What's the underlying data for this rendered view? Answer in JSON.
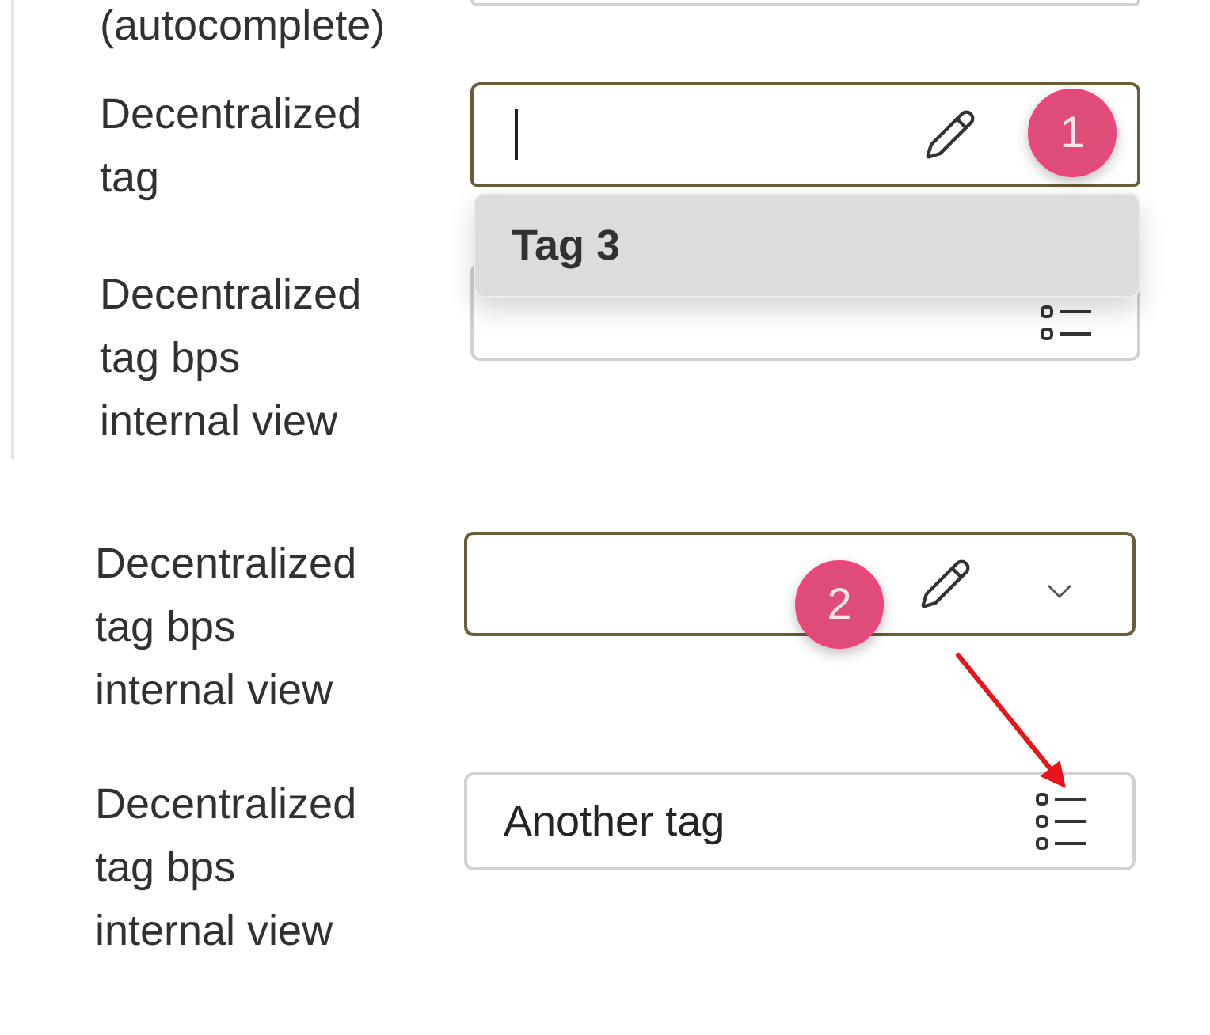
{
  "panels": [
    {
      "kind": "bordered",
      "rows": [
        {
          "label": "(autocomplete)",
          "field": {
            "kind": "clipped",
            "active": false
          }
        },
        {
          "label": "Decentralized tag",
          "field": {
            "kind": "combo",
            "active": true,
            "caret": true,
            "expanded": true,
            "options": [
              {
                "label": "Tag 3",
                "selected": true
              }
            ],
            "badge": {
              "text": "1",
              "arrow": false
            }
          }
        },
        {
          "label": "Decentralized tag bps internal view",
          "field": {
            "kind": "lookup",
            "active": false
          }
        }
      ]
    },
    {
      "kind": "plain",
      "rows": [
        {
          "label": "Decentralized tag bps internal view",
          "field": {
            "kind": "combo",
            "active": true,
            "caret": false,
            "expanded": false,
            "badge": {
              "text": "2",
              "arrow": true
            }
          }
        },
        {
          "label": "Decentralized tag bps internal view",
          "field": {
            "kind": "lookup",
            "active": false,
            "value": "Another tag"
          }
        }
      ]
    }
  ]
}
